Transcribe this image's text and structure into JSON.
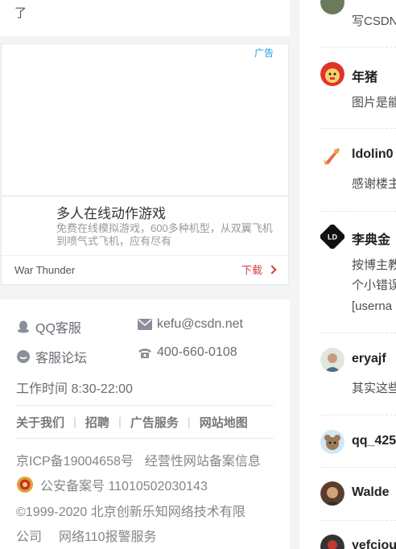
{
  "top_fragment": {
    "text": "了"
  },
  "ad": {
    "label": "广告",
    "title": "多人在线动作游戏",
    "description": "免费在线模拟游戏，600多种机型，从双翼飞机到喷气式飞机，应有尽有",
    "brand": "War Thunder",
    "cta": "下载"
  },
  "footer": {
    "qq_service": "QQ客服",
    "email": "kefu@csdn.net",
    "forum": "客服论坛",
    "phone": "400-660-0108",
    "work_hours": "工作时间 8:30-22:00",
    "links": [
      "关于我们",
      "招聘",
      "广告服务",
      "网站地图"
    ],
    "icp": "京ICP备19004658号",
    "icp_info": "经营性网站备案信息",
    "police": "公安备案号 11010502030143",
    "copyright": "©1999-2020 北京创新乐知网络技术有限",
    "company": "公司",
    "report": "网络110报警服务"
  },
  "comments": [
    {
      "user": "",
      "text": "写CSDN"
    },
    {
      "user": "年猪",
      "text": "图片是能"
    },
    {
      "user": "ldolin0",
      "text": "感谢楼主"
    },
    {
      "user": "李典金",
      "text_lines": [
        "按博主教",
        "个小错误",
        "[userna"
      ]
    },
    {
      "user": "eryajf",
      "text": "其实这些"
    },
    {
      "user": "qq_425",
      "text": ""
    },
    {
      "user": "Walde",
      "text": ""
    },
    {
      "user": "yefciou",
      "text": ""
    }
  ],
  "colors": {
    "ad_label": "#1ea0e2",
    "cta": "#d53c3c",
    "footer_text": "#858585",
    "icon": "#8a8f99"
  }
}
